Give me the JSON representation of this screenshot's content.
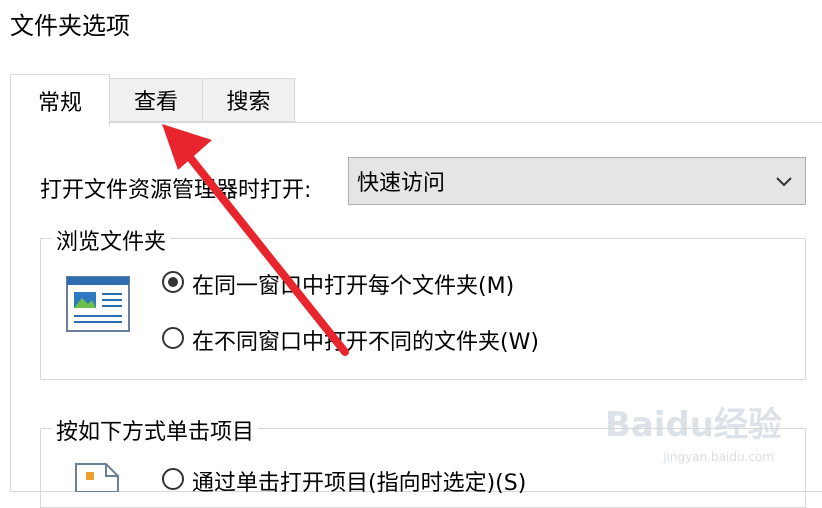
{
  "window": {
    "title": "文件夹选项"
  },
  "tabs": [
    {
      "label": "常规"
    },
    {
      "label": "查看"
    },
    {
      "label": "搜索"
    }
  ],
  "general": {
    "open_label": "打开文件资源管理器时打开:",
    "open_value": "快速访问",
    "browse_group": {
      "title": "浏览文件夹",
      "options": [
        {
          "label": "在同一窗口中打开每个文件夹(M)",
          "checked": true
        },
        {
          "label": "在不同窗口中打开不同的文件夹(W)",
          "checked": false
        }
      ]
    },
    "click_group": {
      "title": "按如下方式单击项目",
      "options": [
        {
          "label": "通过单击打开项目(指向时选定)(S)",
          "checked": false
        }
      ]
    }
  },
  "watermark": {
    "brand": "Baidu经验",
    "url": "jingyan.baidu.com"
  },
  "colors": {
    "arrow": "#e8242c"
  }
}
